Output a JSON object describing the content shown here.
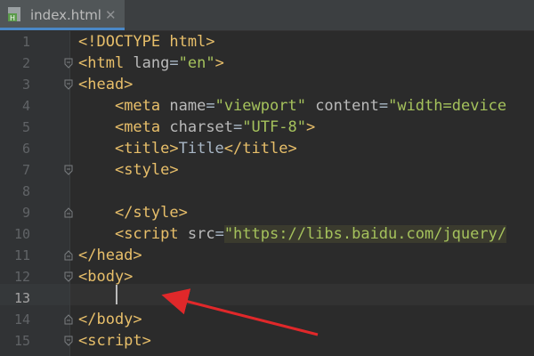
{
  "tab": {
    "filename": "index.html",
    "close_glyph": "✕",
    "file_icon_letter": "H"
  },
  "current_line_index": 12,
  "lines": [
    {
      "n": "1",
      "fold": "",
      "parts": [
        {
          "c": "tag",
          "t": "<!DOCTYPE html>"
        }
      ]
    },
    {
      "n": "2",
      "fold": "open",
      "parts": [
        {
          "c": "tag",
          "t": "<html "
        },
        {
          "c": "attr",
          "t": "lang"
        },
        {
          "c": "txt",
          "t": "="
        },
        {
          "c": "str",
          "t": "\"en\""
        },
        {
          "c": "tag",
          "t": ">"
        }
      ]
    },
    {
      "n": "3",
      "fold": "open",
      "parts": [
        {
          "c": "tag",
          "t": "<head>"
        }
      ]
    },
    {
      "n": "4",
      "fold": "",
      "parts": [
        {
          "c": "txt",
          "t": "    "
        },
        {
          "c": "tag",
          "t": "<meta "
        },
        {
          "c": "attr",
          "t": "name"
        },
        {
          "c": "txt",
          "t": "="
        },
        {
          "c": "str",
          "t": "\"viewport\""
        },
        {
          "c": "txt",
          "t": " "
        },
        {
          "c": "attr",
          "t": "content"
        },
        {
          "c": "txt",
          "t": "="
        },
        {
          "c": "str",
          "t": "\"width=device"
        }
      ]
    },
    {
      "n": "5",
      "fold": "",
      "parts": [
        {
          "c": "txt",
          "t": "    "
        },
        {
          "c": "tag",
          "t": "<meta "
        },
        {
          "c": "attr",
          "t": "charset"
        },
        {
          "c": "txt",
          "t": "="
        },
        {
          "c": "str",
          "t": "\"UTF-8\""
        },
        {
          "c": "tag",
          "t": ">"
        }
      ]
    },
    {
      "n": "6",
      "fold": "",
      "parts": [
        {
          "c": "txt",
          "t": "    "
        },
        {
          "c": "tag",
          "t": "<title>"
        },
        {
          "c": "txt",
          "t": "Title"
        },
        {
          "c": "tag",
          "t": "</title>"
        }
      ]
    },
    {
      "n": "7",
      "fold": "open",
      "parts": [
        {
          "c": "txt",
          "t": "    "
        },
        {
          "c": "tag",
          "t": "<style>"
        }
      ]
    },
    {
      "n": "8",
      "fold": "",
      "parts": []
    },
    {
      "n": "9",
      "fold": "close",
      "parts": [
        {
          "c": "txt",
          "t": "    "
        },
        {
          "c": "tag",
          "t": "</style>"
        }
      ]
    },
    {
      "n": "10",
      "fold": "",
      "parts": [
        {
          "c": "txt",
          "t": "    "
        },
        {
          "c": "tag",
          "t": "<script "
        },
        {
          "c": "attr",
          "t": "src"
        },
        {
          "c": "txt",
          "t": "="
        },
        {
          "c": "str url",
          "t": "\"https://libs.baidu.com/jquery/"
        }
      ]
    },
    {
      "n": "11",
      "fold": "close",
      "parts": [
        {
          "c": "tag",
          "t": "</head>"
        }
      ]
    },
    {
      "n": "12",
      "fold": "open",
      "parts": [
        {
          "c": "tag",
          "t": "<body>"
        }
      ]
    },
    {
      "n": "13",
      "fold": "",
      "parts": []
    },
    {
      "n": "14",
      "fold": "close",
      "parts": [
        {
          "c": "tag",
          "t": "</body>"
        }
      ]
    },
    {
      "n": "15",
      "fold": "open",
      "parts": [
        {
          "c": "tag",
          "t": "<script>"
        }
      ]
    }
  ],
  "annotation": {
    "arrow_color": "#e0282a",
    "points_to": "cursor on line 13"
  },
  "colors": {
    "background": "#2b2b2b",
    "tag": "#e8bf6a",
    "attribute": "#bababa",
    "string": "#a5c25c",
    "text": "#a9b7c6"
  }
}
